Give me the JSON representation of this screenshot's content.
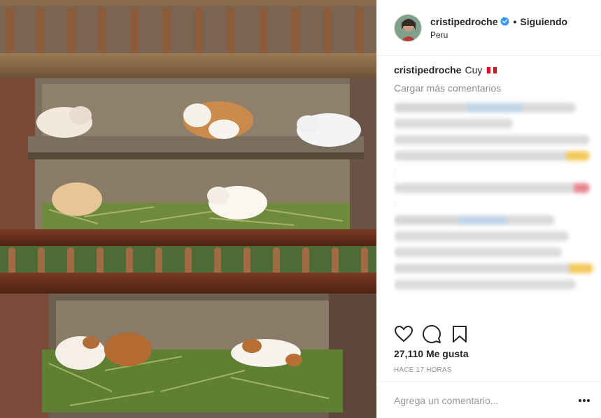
{
  "post": {
    "username": "cristipedroche",
    "follow_status": "Siguiendo",
    "separator": "•",
    "location": "Peru",
    "caption_user": "cristipedroche",
    "caption_text": "Cuy",
    "load_more": "Cargar más comentarios",
    "likes": "27,110 Me gusta",
    "timestamp": "HACE 17 HORAS",
    "comment_placeholder": "Agrega un comentario..."
  },
  "icons": {
    "verified": "verified-badge-icon",
    "like": "heart-icon",
    "comment": "comment-bubble-icon",
    "save": "bookmark-icon",
    "more": "ellipsis-icon",
    "flag": "peru-flag-icon"
  },
  "colors": {
    "verified_blue": "#3897f0",
    "muted_text": "#8e8e8e",
    "divider": "#efefef",
    "flag_red": "#d91023"
  }
}
